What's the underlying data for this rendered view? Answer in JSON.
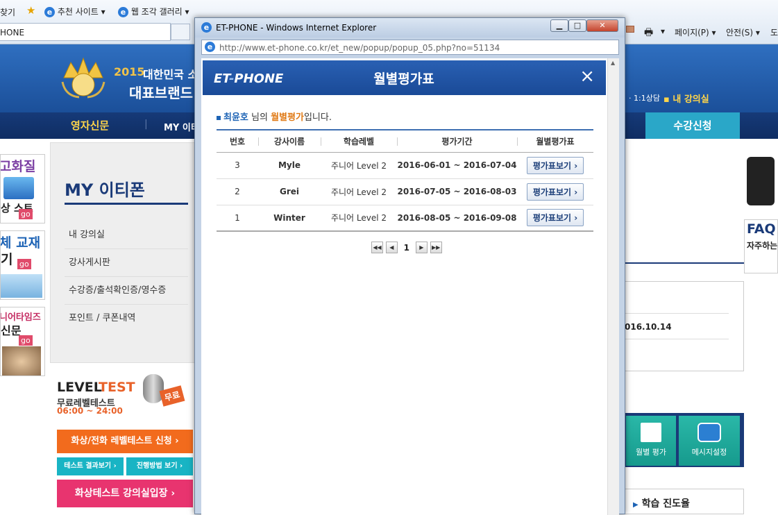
{
  "ie": {
    "partial_left_text": "찾기",
    "favorites_links": [
      {
        "label": "추천 사이트",
        "icon": "ie-icon"
      },
      {
        "label": "웹 조각 갤러리",
        "icon": "ie-icon"
      }
    ],
    "tab_partial": "HONE",
    "menu_page": "페이지(P)",
    "menu_safety": "안전(S)",
    "menu_partial": "도"
  },
  "site": {
    "banner_year": "2015",
    "banner_line1": "대한민국 소",
    "banner_line2": "대표브랜드",
    "top_links": [
      "1:1상담",
      "내 강의실"
    ],
    "nav": [
      "영자신문",
      "MY 이티"
    ],
    "register_button": "수강신청",
    "left_banners": [
      {
        "text": "고화질",
        "sub": "상 스트",
        "badge": "go"
      },
      {
        "text": "체 교재",
        "sub": "기",
        "badge": "go"
      },
      {
        "text": "니어타임즈",
        "sub": "신문",
        "badge": "go"
      }
    ],
    "sidebar": {
      "title": "MY 이티폰",
      "items": [
        "내 강의실",
        "강사게시판",
        "수강증/출석확인증/영수증",
        "포인트 / 쿠폰내역"
      ]
    },
    "level_test": {
      "title_a": "LEVEL",
      "title_b": "TEST",
      "subtitle": "무료레벨테스트",
      "time": "06:00 ~ 24:00",
      "free_badge": "무료",
      "btn_apply": "화상/전화 레벨테스트 신청 ›",
      "btn_result": "테스트 결과보기 ›",
      "btn_method": "진행방법 보기 ›",
      "btn_enter": "화상테스트 강의실입장 ›"
    },
    "right": {
      "faq_title": "FAQ",
      "faq_sub": "자주하는",
      "date_partial": "016.10.14",
      "tile_eval": "월별 평가",
      "tile_message": "메시지설정",
      "progress_label": "학습 진도율"
    }
  },
  "popup": {
    "window_title": "ET-PHONE - Windows Internet Explorer",
    "url": "http://www.et-phone.co.kr/et_new/popup/popup_05.php?no=51134",
    "logo_a": "ET",
    "logo_dash": "-",
    "logo_b": "PHONE",
    "title": "월별평가표",
    "intro": {
      "name": "최윤호",
      "mid": "님의",
      "highlight": "월별평가",
      "end": "입니다."
    },
    "columns": [
      "번호",
      "강사이름",
      "학습레벨",
      "평가기간",
      "월별평가표"
    ],
    "rows": [
      {
        "no": "3",
        "teacher": "Myle",
        "level": "주니어 Level 2",
        "period": "2016-06-01 ~ 2016-07-04",
        "button": "평가표보기 ›"
      },
      {
        "no": "2",
        "teacher": "Grei",
        "level": "주니어 Level 2",
        "period": "2016-07-05 ~ 2016-08-03",
        "button": "평가표보기 ›"
      },
      {
        "no": "1",
        "teacher": "Winter",
        "level": "주니어 Level 2",
        "period": "2016-08-05 ~ 2016-09-08",
        "button": "평가표보기 ›"
      }
    ],
    "pager": {
      "first": "◀◀",
      "prev": "◀",
      "current": "1",
      "next": "▶",
      "last": "▶▶"
    },
    "close_glyph": "×"
  }
}
